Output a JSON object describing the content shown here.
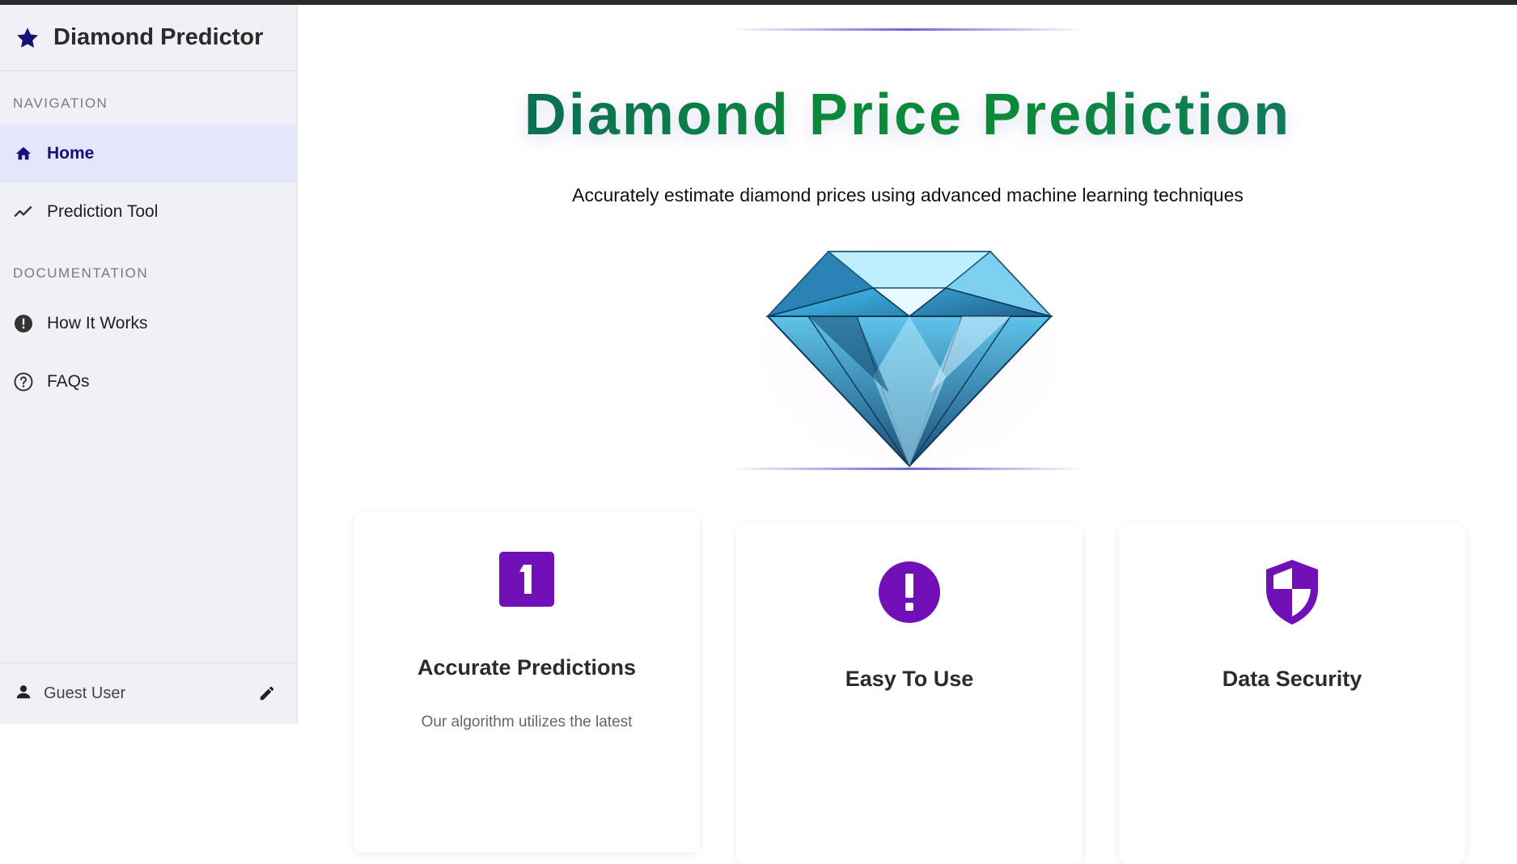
{
  "app": {
    "title": "Diamond Predictor"
  },
  "sidebar": {
    "nav_label": "NAVIGATION",
    "nav_items": [
      {
        "label": "Home",
        "icon": "home-icon",
        "active": true
      },
      {
        "label": "Prediction Tool",
        "icon": "trending-up-icon",
        "active": false
      }
    ],
    "doc_label": "DOCUMENTATION",
    "doc_items": [
      {
        "label": "How It Works",
        "icon": "alert-circle-icon"
      },
      {
        "label": "FAQs",
        "icon": "help-circle-icon"
      }
    ],
    "user": {
      "name": "Guest User",
      "icon": "person-icon",
      "action_icon": "edit-icon"
    }
  },
  "hero": {
    "title": "Diamond Price Prediction",
    "subtitle": "Accurately estimate diamond prices using advanced machine learning techniques",
    "image": "diamond-image"
  },
  "features": [
    {
      "title": "Accurate Predictions",
      "icon": "number-one-icon",
      "description": "Our algorithm utilizes the latest"
    },
    {
      "title": "Easy To Use",
      "icon": "exclamation-circle-icon",
      "description": ""
    },
    {
      "title": "Data Security",
      "icon": "shield-icon",
      "description": ""
    }
  ],
  "colors": {
    "accent": "#150f7a",
    "active_bg": "#e3e6fb",
    "feature_icon": "#7210b8",
    "title_gradient_start": "#0d5b6b",
    "title_gradient_mid": "#0c8a3a"
  }
}
